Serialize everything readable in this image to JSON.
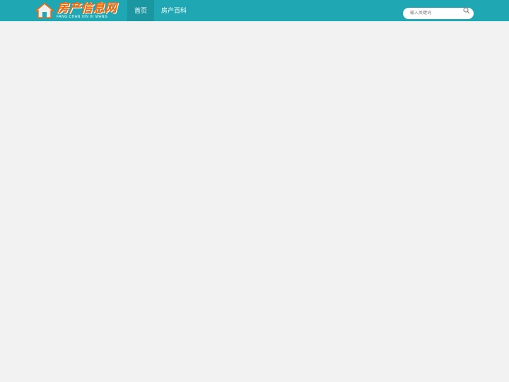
{
  "header": {
    "logo_text": "房产信息网",
    "logo_subtext": "FANG CHAN XIN XI WANG",
    "nav": [
      {
        "label": "首页",
        "active": true
      },
      {
        "label": "房产百科",
        "active": false
      }
    ],
    "search_placeholder": "输入关键词"
  },
  "colors": {
    "header_bg": "#1fa8b3",
    "accent_orange": "#ff6600"
  }
}
